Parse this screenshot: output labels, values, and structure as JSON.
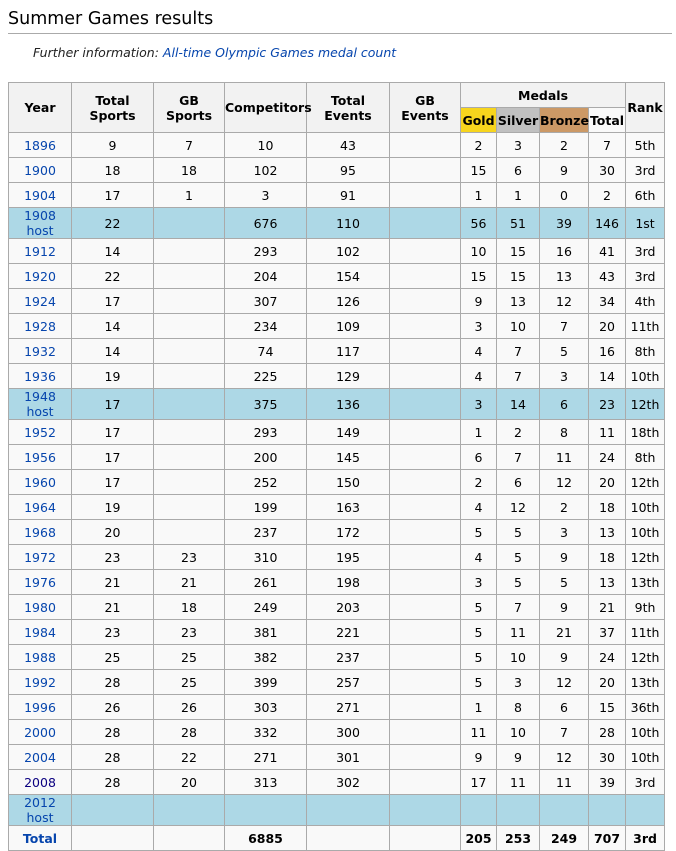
{
  "heading": "Summer Games results",
  "further": {
    "prefix": "Further information: ",
    "link": "All-time Olympic Games medal count"
  },
  "headers": {
    "year": "Year",
    "total_sports": "Total Sports",
    "gb_sports": "GB Sports",
    "competitors": "Competitors",
    "total_events": "Total Events",
    "gb_events": "GB Events",
    "medals": "Medals",
    "gold": "Gold",
    "silver": "Silver",
    "bronze": "Bronze",
    "total": "Total",
    "rank": "Rank"
  },
  "colors": {
    "gold": "#f7d51d",
    "silver": "#c0c0c0",
    "bronze": "#cc9966",
    "host_row": "#add8e6",
    "link": "#0645ad"
  },
  "rows": [
    {
      "year": "1896",
      "host": false,
      "total_sports": "9",
      "gb_sports": "7",
      "competitors": "10",
      "total_events": "43",
      "gb_events": "",
      "gold": "2",
      "silver": "3",
      "bronze": "2",
      "total": "7",
      "rank": "5th"
    },
    {
      "year": "1900",
      "host": false,
      "total_sports": "18",
      "gb_sports": "18",
      "competitors": "102",
      "total_events": "95",
      "gb_events": "",
      "gold": "15",
      "silver": "6",
      "bronze": "9",
      "total": "30",
      "rank": "3rd"
    },
    {
      "year": "1904",
      "host": false,
      "total_sports": "17",
      "gb_sports": "1",
      "competitors": "3",
      "total_events": "91",
      "gb_events": "",
      "gold": "1",
      "silver": "1",
      "bronze": "0",
      "total": "2",
      "rank": "6th"
    },
    {
      "year": "1908 host",
      "host": true,
      "total_sports": "22",
      "gb_sports": "",
      "competitors": "676",
      "total_events": "110",
      "gb_events": "",
      "gold": "56",
      "silver": "51",
      "bronze": "39",
      "total": "146",
      "rank": "1st"
    },
    {
      "year": "1912",
      "host": false,
      "total_sports": "14",
      "gb_sports": "",
      "competitors": "293",
      "total_events": "102",
      "gb_events": "",
      "gold": "10",
      "silver": "15",
      "bronze": "16",
      "total": "41",
      "rank": "3rd"
    },
    {
      "year": "1920",
      "host": false,
      "total_sports": "22",
      "gb_sports": "",
      "competitors": "204",
      "total_events": "154",
      "gb_events": "",
      "gold": "15",
      "silver": "15",
      "bronze": "13",
      "total": "43",
      "rank": "3rd"
    },
    {
      "year": "1924",
      "host": false,
      "total_sports": "17",
      "gb_sports": "",
      "competitors": "307",
      "total_events": "126",
      "gb_events": "",
      "gold": "9",
      "silver": "13",
      "bronze": "12",
      "total": "34",
      "rank": "4th"
    },
    {
      "year": "1928",
      "host": false,
      "total_sports": "14",
      "gb_sports": "",
      "competitors": "234",
      "total_events": "109",
      "gb_events": "",
      "gold": "3",
      "silver": "10",
      "bronze": "7",
      "total": "20",
      "rank": "11th"
    },
    {
      "year": "1932",
      "host": false,
      "total_sports": "14",
      "gb_sports": "",
      "competitors": "74",
      "total_events": "117",
      "gb_events": "",
      "gold": "4",
      "silver": "7",
      "bronze": "5",
      "total": "16",
      "rank": "8th"
    },
    {
      "year": "1936",
      "host": false,
      "total_sports": "19",
      "gb_sports": "",
      "competitors": "225",
      "total_events": "129",
      "gb_events": "",
      "gold": "4",
      "silver": "7",
      "bronze": "3",
      "total": "14",
      "rank": "10th"
    },
    {
      "year": "1948 host",
      "host": true,
      "total_sports": "17",
      "gb_sports": "",
      "competitors": "375",
      "total_events": "136",
      "gb_events": "",
      "gold": "3",
      "silver": "14",
      "bronze": "6",
      "total": "23",
      "rank": "12th"
    },
    {
      "year": "1952",
      "host": false,
      "total_sports": "17",
      "gb_sports": "",
      "competitors": "293",
      "total_events": "149",
      "gb_events": "",
      "gold": "1",
      "silver": "2",
      "bronze": "8",
      "total": "11",
      "rank": "18th"
    },
    {
      "year": "1956",
      "host": false,
      "total_sports": "17",
      "gb_sports": "",
      "competitors": "200",
      "total_events": "145",
      "gb_events": "",
      "gold": "6",
      "silver": "7",
      "bronze": "11",
      "total": "24",
      "rank": "8th"
    },
    {
      "year": "1960",
      "host": false,
      "total_sports": "17",
      "gb_sports": "",
      "competitors": "252",
      "total_events": "150",
      "gb_events": "",
      "gold": "2",
      "silver": "6",
      "bronze": "12",
      "total": "20",
      "rank": "12th"
    },
    {
      "year": "1964",
      "host": false,
      "total_sports": "19",
      "gb_sports": "",
      "competitors": "199",
      "total_events": "163",
      "gb_events": "",
      "gold": "4",
      "silver": "12",
      "bronze": "2",
      "total": "18",
      "rank": "10th"
    },
    {
      "year": "1968",
      "host": false,
      "total_sports": "20",
      "gb_sports": "",
      "competitors": "237",
      "total_events": "172",
      "gb_events": "",
      "gold": "5",
      "silver": "5",
      "bronze": "3",
      "total": "13",
      "rank": "10th"
    },
    {
      "year": "1972",
      "host": false,
      "total_sports": "23",
      "gb_sports": "23",
      "competitors": "310",
      "total_events": "195",
      "gb_events": "",
      "gold": "4",
      "silver": "5",
      "bronze": "9",
      "total": "18",
      "rank": "12th"
    },
    {
      "year": "1976",
      "host": false,
      "total_sports": "21",
      "gb_sports": "21",
      "competitors": "261",
      "total_events": "198",
      "gb_events": "",
      "gold": "3",
      "silver": "5",
      "bronze": "5",
      "total": "13",
      "rank": "13th"
    },
    {
      "year": "1980",
      "host": false,
      "total_sports": "21",
      "gb_sports": "18",
      "competitors": "249",
      "total_events": "203",
      "gb_events": "",
      "gold": "5",
      "silver": "7",
      "bronze": "9",
      "total": "21",
      "rank": "9th"
    },
    {
      "year": "1984",
      "host": false,
      "total_sports": "23",
      "gb_sports": "23",
      "competitors": "381",
      "total_events": "221",
      "gb_events": "",
      "gold": "5",
      "silver": "11",
      "bronze": "21",
      "total": "37",
      "rank": "11th"
    },
    {
      "year": "1988",
      "host": false,
      "total_sports": "25",
      "gb_sports": "25",
      "competitors": "382",
      "total_events": "237",
      "gb_events": "",
      "gold": "5",
      "silver": "10",
      "bronze": "9",
      "total": "24",
      "rank": "12th"
    },
    {
      "year": "1992",
      "host": false,
      "total_sports": "28",
      "gb_sports": "25",
      "competitors": "399",
      "total_events": "257",
      "gb_events": "",
      "gold": "5",
      "silver": "3",
      "bronze": "12",
      "total": "20",
      "rank": "13th"
    },
    {
      "year": "1996",
      "host": false,
      "total_sports": "26",
      "gb_sports": "26",
      "competitors": "303",
      "total_events": "271",
      "gb_events": "",
      "gold": "1",
      "silver": "8",
      "bronze": "6",
      "total": "15",
      "rank": "36th"
    },
    {
      "year": "2000",
      "host": false,
      "total_sports": "28",
      "gb_sports": "28",
      "competitors": "332",
      "total_events": "300",
      "gb_events": "",
      "gold": "11",
      "silver": "10",
      "bronze": "7",
      "total": "28",
      "rank": "10th"
    },
    {
      "year": "2004",
      "host": false,
      "total_sports": "28",
      "gb_sports": "22",
      "competitors": "271",
      "total_events": "301",
      "gb_events": "",
      "gold": "9",
      "silver": "9",
      "bronze": "12",
      "total": "30",
      "rank": "10th"
    },
    {
      "year": "2008",
      "host": false,
      "visited": true,
      "total_sports": "28",
      "gb_sports": "20",
      "competitors": "313",
      "total_events": "302",
      "gb_events": "",
      "gold": "17",
      "silver": "11",
      "bronze": "11",
      "total": "39",
      "rank": "3rd"
    },
    {
      "year": "2012 host",
      "host": true,
      "total_sports": "",
      "gb_sports": "",
      "competitors": "",
      "total_events": "",
      "gb_events": "",
      "gold": "",
      "silver": "",
      "bronze": "",
      "total": "",
      "rank": ""
    }
  ],
  "totals": {
    "label": "Total",
    "total_sports": "",
    "gb_sports": "",
    "competitors": "6885",
    "total_events": "",
    "gb_events": "",
    "gold": "205",
    "silver": "253",
    "bronze": "249",
    "total": "707",
    "rank": "3rd"
  }
}
